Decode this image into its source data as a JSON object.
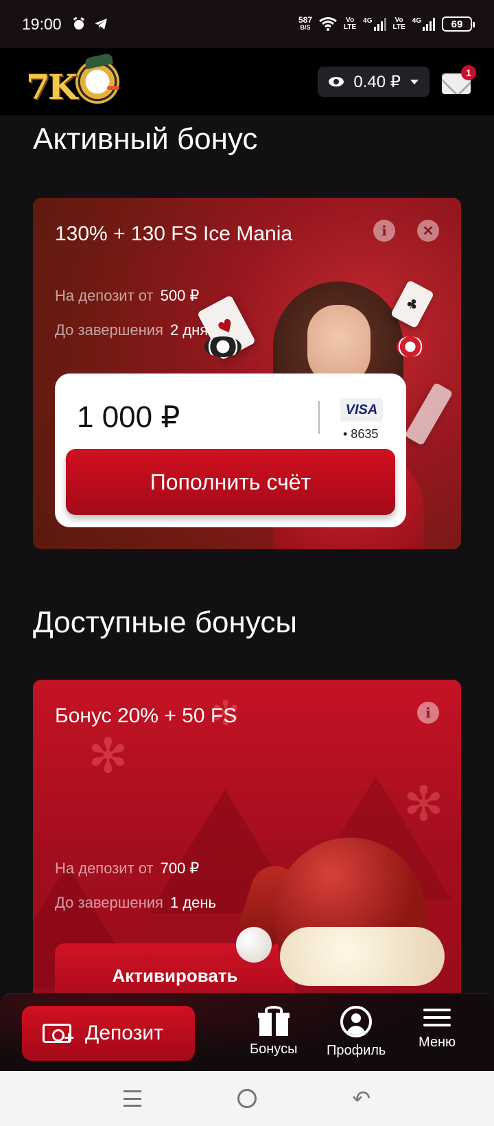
{
  "status_bar": {
    "time": "19:00",
    "net_speed": "587",
    "net_unit": "B/S",
    "sim1": "Vo\nLTE",
    "sim_net": "4G",
    "battery": "69",
    "alarm_icon": "alarm-icon",
    "telegram_icon": "telegram-icon"
  },
  "header": {
    "logo": "7K",
    "balance": "0.40 ₽",
    "mail_badge": "1"
  },
  "active_section": {
    "title": "Активный бонус",
    "card": {
      "title": "130% + 130 FS Ice Mania",
      "deposit_label": "На депозит от",
      "deposit_value": "500 ₽",
      "expiry_label": "До завершения",
      "expiry_value": "2 дня",
      "amount": "1 000 ₽",
      "card_brand": "VISA",
      "card_number": "• 8635",
      "button": "Пополнить счёт"
    }
  },
  "available_section": {
    "title": "Доступные бонусы",
    "card": {
      "title": "Бонус 20% + 50 FS",
      "deposit_label": "На депозит от",
      "deposit_value": "700 ₽",
      "expiry_label": "До завершения",
      "expiry_value": "1 день",
      "button": "Активировать"
    }
  },
  "bottom_nav": {
    "deposit": "Депозит",
    "bonuses": "Бонусы",
    "profile": "Профиль",
    "menu": "Меню"
  }
}
